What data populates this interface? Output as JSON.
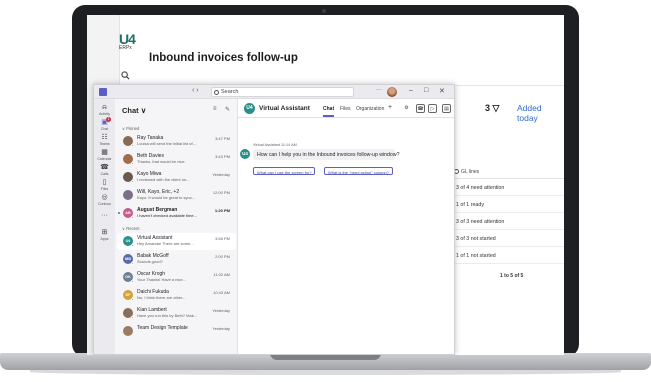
{
  "erp": {
    "logo_mark": "U4",
    "logo_sub": "ERPx",
    "search_icon": "search-icon",
    "page_title": "Inbound invoices follow-up",
    "count": "3 ▽",
    "added_today": "Added today",
    "table_header": "GL lines",
    "rows": [
      "3 of 4 need attention",
      "1 of 1 ready",
      "3 of 3 need attention",
      "3 of 3 not started",
      "1 of 1 not started"
    ],
    "pager": "1 to 5 of 5"
  },
  "teams": {
    "search_placeholder": "Search",
    "nav": "‹  ›",
    "more": "···",
    "window_controls": [
      "–",
      "□",
      "✕"
    ],
    "rail": [
      {
        "icon": "bell-icon",
        "glyph": "⍾",
        "label": "Activity"
      },
      {
        "icon": "chat-icon",
        "glyph": "▣",
        "label": "Chat",
        "active": true,
        "badge": "1"
      },
      {
        "icon": "teams-icon",
        "glyph": "☷",
        "label": "Teams"
      },
      {
        "icon": "calendar-icon",
        "glyph": "▦",
        "label": "Calendar"
      },
      {
        "icon": "calls-icon",
        "glyph": "☎",
        "label": "Calls"
      },
      {
        "icon": "files-icon",
        "glyph": "▯",
        "label": "Files"
      },
      {
        "icon": "contoso-icon",
        "glyph": "◎",
        "label": "Contoso"
      },
      {
        "icon": "more-icon",
        "glyph": "···",
        "label": ""
      },
      {
        "icon": "apps-icon",
        "glyph": "⊞",
        "label": "Apps"
      }
    ],
    "chat_list": {
      "header": "Chat ∨",
      "filter_icon": "≡",
      "compose_icon": "✎",
      "pinned_label": "∨ Pinned",
      "recent_label": "∨ Recent",
      "pinned": [
        {
          "name": "Ray Tanaka",
          "preview": "Louisa will send the initial list of...",
          "time": "3:47 PM",
          "initials": "",
          "color": "#8a6a55"
        },
        {
          "name": "Beth Davies",
          "preview": "Thanks, that would be nice.",
          "time": "3:43 PM",
          "initials": "",
          "color": "#a06c4c"
        },
        {
          "name": "Kayo Miwa",
          "preview": "I reviewed with the client on...",
          "time": "Yesterday",
          "initials": "",
          "color": "#6b5a4e"
        },
        {
          "name": "Will, Kayo, Eric, +2",
          "preview": "Kayo: It would be great to sync...",
          "time": "12:00 PM",
          "initials": "",
          "color": "#7b6f86"
        },
        {
          "name": "August Bergman",
          "preview": "I haven't checked available time...",
          "time": "1:20 PM",
          "initials": "AB",
          "color": "#c75c8c",
          "unread": true
        }
      ],
      "recent": [
        {
          "name": "Virtual Assistant",
          "preview": "Hey Amanda! There are some...",
          "time": "3:58 PM",
          "initials": "U4",
          "color": "#2a8f88",
          "selected": true
        },
        {
          "name": "Babak McGoff",
          "preview": "Sounds good?",
          "time": "2:00 PM",
          "initials": "MB",
          "color": "#5b6aa8"
        },
        {
          "name": "Oscar Krogh",
          "preview": "Your Thanks! Have a nice...",
          "time": "11:02 AM",
          "initials": "OK",
          "color": "#6d7f8f"
        },
        {
          "name": "Daichi Fukuda",
          "preview": "No, I think there are other...",
          "time": "10:43 AM",
          "initials": "DF",
          "color": "#d4a13a"
        },
        {
          "name": "Kian Lambert",
          "preview": "Have you run this by Beth? Mak...",
          "time": "Yesterday",
          "initials": "",
          "color": "#8b6e5a"
        },
        {
          "name": "Team Design Template",
          "preview": "",
          "time": "Yesterday",
          "initials": "",
          "color": "#9a7b62"
        }
      ]
    },
    "conversation": {
      "avatar": "U4",
      "title": "Virtual Assistant",
      "tabs": [
        "Chat",
        "Files",
        "Organization"
      ],
      "add_tab": "+",
      "icons": [
        "⚙",
        "☎",
        "▷",
        "▤"
      ],
      "message_meta": "Virtual Assistant  11:14 AM",
      "message": "How can I help you in the Inbound invoices follow-up window?",
      "suggestions": [
        "What can I use the screen for?",
        "What is the \"need action\" column?"
      ]
    }
  }
}
